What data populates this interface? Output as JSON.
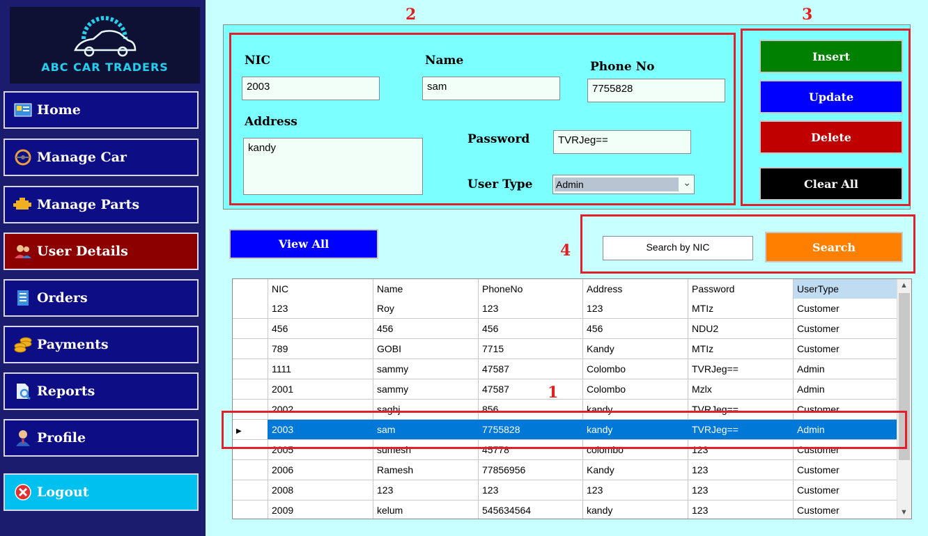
{
  "sidebar": {
    "brand": "ABC CAR TRADERS",
    "items": [
      {
        "label": "Home",
        "icon": "dashboard-icon"
      },
      {
        "label": "Manage Car",
        "icon": "steering-wheel-icon"
      },
      {
        "label": "Manage Parts",
        "icon": "engine-icon"
      },
      {
        "label": "User Details",
        "icon": "users-icon"
      },
      {
        "label": "Orders",
        "icon": "receipt-icon"
      },
      {
        "label": "Payments",
        "icon": "coins-icon"
      },
      {
        "label": "Reports",
        "icon": "report-icon"
      },
      {
        "label": "Profile",
        "icon": "person-icon"
      }
    ],
    "logout": "Logout",
    "active_color": "#8c0000"
  },
  "form": {
    "nic_label": "NIC",
    "nic_value": "2003",
    "name_label": "Name",
    "name_value": "sam",
    "phone_label": "Phone No",
    "phone_value": "7755828",
    "address_label": "Address",
    "address_value": "kandy",
    "password_label": "Password",
    "password_value": "TVRJeg==",
    "usertype_label": "User Type",
    "usertype_value": "Admin"
  },
  "actions": {
    "insert": "Insert",
    "update": "Update",
    "delete": "Delete",
    "clear": "Clear All"
  },
  "view_all": "View All",
  "search": {
    "placeholder": "Search by NIC",
    "button": "Search"
  },
  "annotations": [
    "1",
    "2",
    "3",
    "4"
  ],
  "grid": {
    "columns": [
      "NIC",
      "Name",
      "PhoneNo",
      "Address",
      "Password",
      "UserType"
    ],
    "rows": [
      [
        "123",
        "Roy",
        "123",
        "123",
        "MTIz",
        "Customer"
      ],
      [
        "456",
        "456",
        "456",
        "456",
        "NDU2",
        "Customer"
      ],
      [
        "789",
        "GOBI",
        "7715",
        "Kandy",
        "MTIz",
        "Customer"
      ],
      [
        "1111",
        "sammy",
        "47587",
        "Colombo",
        "TVRJeg==",
        "Admin"
      ],
      [
        "2001",
        "sammy",
        "47587",
        "Colombo",
        "Mzlx",
        "Admin"
      ],
      [
        "2002",
        "saghj",
        "856",
        "kandy",
        "TVRJeg==",
        "Customer"
      ],
      [
        "2003",
        "sam",
        "7755828",
        "kandy",
        "TVRJeg==",
        "Admin"
      ],
      [
        "2005",
        "sumesh",
        "45778",
        "colombo",
        "123",
        "Customer"
      ],
      [
        "2006",
        "Ramesh",
        "77856956",
        "Kandy",
        "123",
        "Customer"
      ],
      [
        "2008",
        "123",
        "123",
        "123",
        "123",
        "Customer"
      ],
      [
        "2009",
        "kelum",
        "545634564",
        "kandy",
        "123",
        "Customer"
      ]
    ],
    "selected_row": 6
  }
}
